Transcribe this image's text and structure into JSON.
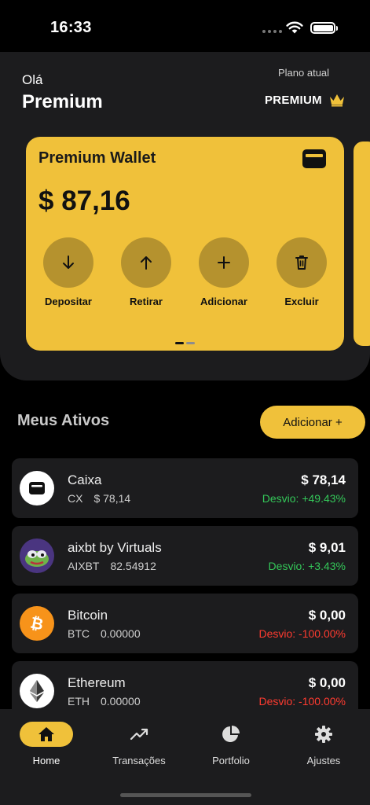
{
  "status": {
    "time": "16:33"
  },
  "header": {
    "greeting": "Olá",
    "user_name": "Premium",
    "plan_label": "Plano atual",
    "plan_value": "PREMIUM"
  },
  "wallet": {
    "title": "Premium Wallet",
    "balance": "$ 87,16",
    "actions": [
      {
        "label": "Depositar",
        "icon": "arrow-down-icon"
      },
      {
        "label": "Retirar",
        "icon": "arrow-up-icon"
      },
      {
        "label": "Adicionar",
        "icon": "plus-icon"
      },
      {
        "label": "Excluir",
        "icon": "trash-icon"
      }
    ]
  },
  "assets_section": {
    "title": "Meus Ativos",
    "add_button": "Adicionar +"
  },
  "assets": [
    {
      "name": "Caixa",
      "symbol": "CX",
      "amount": "$ 78,14",
      "value": "$ 78,14",
      "deviation": "Desvio: +49.43%",
      "trend": "positive",
      "icon": "wallet-icon"
    },
    {
      "name": "aixbt by Virtuals",
      "symbol": "AIXBT",
      "amount": "82.54912",
      "value": "$ 9,01",
      "deviation": "Desvio: +3.43%",
      "trend": "positive",
      "icon": "aixbt-logo-icon"
    },
    {
      "name": "Bitcoin",
      "symbol": "BTC",
      "amount": "0.00000",
      "value": "$ 0,00",
      "deviation": "Desvio: -100.00%",
      "trend": "negative",
      "icon": "bitcoin-icon"
    },
    {
      "name": "Ethereum",
      "symbol": "ETH",
      "amount": "0.00000",
      "value": "$ 0,00",
      "deviation": "Desvio: -100.00%",
      "trend": "negative",
      "icon": "ethereum-icon"
    }
  ],
  "nav": [
    {
      "label": "Home",
      "icon": "home-icon",
      "active": true
    },
    {
      "label": "Transações",
      "icon": "trend-line-icon",
      "active": false
    },
    {
      "label": "Portfolio",
      "icon": "pie-chart-icon",
      "active": false
    },
    {
      "label": "Ajustes",
      "icon": "gear-icon",
      "active": false
    }
  ],
  "colors": {
    "accent": "#f0c13a",
    "positive": "#34c759",
    "negative": "#ff3b30",
    "surface": "#1c1c1e",
    "action_circle": "#b5922e",
    "bitcoin": "#f7931a"
  }
}
